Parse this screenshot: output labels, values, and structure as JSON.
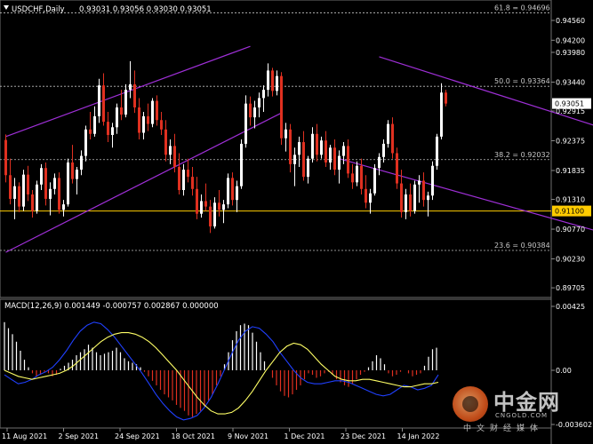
{
  "header": {
    "symbol_label": "USDCHF,Daily",
    "ohlc": "0.93031 0.93056 0.93030 0.93051"
  },
  "macd": {
    "label": "MACD(12,26,9) 0.001449 -0.000757 0.002867 0.000000",
    "ticks": [
      "0.00425",
      "0.00",
      "-0.003602"
    ]
  },
  "colors": {
    "background": "#000000",
    "bull": "#ffffff",
    "bear": "#e03020",
    "channel": "#9e2fd6",
    "support": "#ffcc00",
    "fib_grid": "#c0c0c0",
    "macd_signal": "#ffff66",
    "macd_line": "#2040ff"
  },
  "chart_data": [
    {
      "type": "candlestick",
      "title": "USDCHF,Daily",
      "ylim": [
        0.8961,
        0.9485
      ],
      "y_ticks": [
        "0.94560",
        "0.94200",
        "0.93980",
        "0.93440",
        "0.92915",
        "0.92375",
        "0.91835",
        "0.91310",
        "0.90770",
        "0.90230",
        "0.89705"
      ],
      "x_tick_labels": [
        "11 Aug 2021",
        "2 Sep 2021",
        "24 Sep 2021",
        "18 Oct 2021",
        "9 Nov 2021",
        "1 Dec 2021",
        "23 Dec 2021",
        "14 Jan 2022"
      ],
      "current_price": "0.93051",
      "support_level": {
        "value": 0.911,
        "label": "0.91100"
      },
      "fibonacci": [
        {
          "level": "61.8",
          "value": 0.94696,
          "label": "61.8 = 0.94696"
        },
        {
          "level": "50.0",
          "value": 0.93364,
          "label": "50.0 = 0.93364"
        },
        {
          "level": "38.2",
          "value": 0.92032,
          "label": "38.2 = 0.92032"
        },
        {
          "level": "23.6",
          "value": 0.90384,
          "label": "23.6 = 0.90384"
        }
      ],
      "channels": [
        {
          "name": "ascending",
          "lines": [
            {
              "from": [
                0,
                0.9245
              ],
              "to": [
                55,
                0.9409
              ]
            },
            {
              "from": [
                0,
                0.9035
              ],
              "to": [
                62,
                0.9288
              ]
            }
          ]
        },
        {
          "name": "descending",
          "lines": [
            {
              "from": [
                84,
                0.939
              ],
              "to": [
                152,
                0.9215
              ]
            },
            {
              "from": [
                75,
                0.9205
              ],
              "to": [
                150,
                0.9035
              ]
            }
          ]
        }
      ],
      "ohlc": [
        [
          0.9239,
          0.9249,
          0.9162,
          0.9175
        ],
        [
          0.9175,
          0.9205,
          0.9122,
          0.9132
        ],
        [
          0.9132,
          0.917,
          0.9095,
          0.9155
        ],
        [
          0.9155,
          0.9162,
          0.9108,
          0.9118
        ],
        [
          0.9118,
          0.9185,
          0.911,
          0.9176
        ],
        [
          0.9176,
          0.9192,
          0.9128,
          0.914
        ],
        [
          0.914,
          0.9148,
          0.9098,
          0.911
        ],
        [
          0.911,
          0.9165,
          0.9105,
          0.9158
        ],
        [
          0.9158,
          0.9195,
          0.9148,
          0.9188
        ],
        [
          0.9188,
          0.9198,
          0.912,
          0.9132
        ],
        [
          0.9132,
          0.9162,
          0.9102,
          0.915
        ],
        [
          0.915,
          0.9178,
          0.914,
          0.917
        ],
        [
          0.917,
          0.918,
          0.9105,
          0.9112
        ],
        [
          0.9112,
          0.913,
          0.91,
          0.9122
        ],
        [
          0.9122,
          0.9205,
          0.9118,
          0.9198
        ],
        [
          0.9198,
          0.923,
          0.916,
          0.9168
        ],
        [
          0.9168,
          0.919,
          0.914,
          0.9185
        ],
        [
          0.9185,
          0.922,
          0.9175,
          0.921
        ],
        [
          0.921,
          0.9265,
          0.92,
          0.9258
        ],
        [
          0.9258,
          0.929,
          0.924,
          0.925
        ],
        [
          0.925,
          0.93,
          0.9245,
          0.9282
        ],
        [
          0.9282,
          0.935,
          0.927,
          0.9338
        ],
        [
          0.9338,
          0.936,
          0.9265,
          0.9272
        ],
        [
          0.9272,
          0.929,
          0.9235,
          0.9248
        ],
        [
          0.9248,
          0.927,
          0.9225,
          0.9262
        ],
        [
          0.9262,
          0.9305,
          0.925,
          0.9298
        ],
        [
          0.9298,
          0.933,
          0.9275,
          0.9285
        ],
        [
          0.9285,
          0.934,
          0.928,
          0.933
        ],
        [
          0.933,
          0.9382,
          0.9315,
          0.934
        ],
        [
          0.934,
          0.9365,
          0.9288,
          0.9298
        ],
        [
          0.9298,
          0.9315,
          0.924,
          0.9252
        ],
        [
          0.9252,
          0.929,
          0.924,
          0.9282
        ],
        [
          0.9282,
          0.9305,
          0.9255,
          0.9268
        ],
        [
          0.9268,
          0.9315,
          0.9262,
          0.931
        ],
        [
          0.931,
          0.932,
          0.9265,
          0.9275
        ],
        [
          0.9275,
          0.929,
          0.9248,
          0.9258
        ],
        [
          0.9258,
          0.9275,
          0.92,
          0.9212
        ],
        [
          0.9212,
          0.924,
          0.9195,
          0.9228
        ],
        [
          0.9228,
          0.925,
          0.918,
          0.919
        ],
        [
          0.919,
          0.9215,
          0.914,
          0.9148
        ],
        [
          0.9148,
          0.9195,
          0.9138,
          0.9185
        ],
        [
          0.9185,
          0.9205,
          0.9162,
          0.9172
        ],
        [
          0.9172,
          0.919,
          0.9138,
          0.915
        ],
        [
          0.915,
          0.9172,
          0.9095,
          0.9105
        ],
        [
          0.9105,
          0.914,
          0.9098,
          0.9128
        ],
        [
          0.9128,
          0.916,
          0.911,
          0.9118
        ],
        [
          0.9118,
          0.913,
          0.907,
          0.9082
        ],
        [
          0.9082,
          0.9135,
          0.9078,
          0.9125
        ],
        [
          0.9125,
          0.9148,
          0.91,
          0.9112
        ],
        [
          0.9112,
          0.913,
          0.9088,
          0.9122
        ],
        [
          0.9122,
          0.9178,
          0.9115,
          0.917
        ],
        [
          0.917,
          0.918,
          0.912,
          0.913
        ],
        [
          0.913,
          0.9165,
          0.9108,
          0.9155
        ],
        [
          0.9155,
          0.924,
          0.915,
          0.9232
        ],
        [
          0.9232,
          0.932,
          0.9225,
          0.9305
        ],
        [
          0.9305,
          0.9318,
          0.9265,
          0.928
        ],
        [
          0.928,
          0.931,
          0.926,
          0.9298
        ],
        [
          0.9298,
          0.9325,
          0.928,
          0.9315
        ],
        [
          0.9315,
          0.9338,
          0.929,
          0.933
        ],
        [
          0.933,
          0.9378,
          0.9318,
          0.9365
        ],
        [
          0.9365,
          0.937,
          0.9318,
          0.9328
        ],
        [
          0.9328,
          0.9365,
          0.932,
          0.9355
        ],
        [
          0.9355,
          0.9362,
          0.923,
          0.9242
        ],
        [
          0.9242,
          0.927,
          0.9218,
          0.9258
        ],
        [
          0.9258,
          0.9268,
          0.918,
          0.9195
        ],
        [
          0.9195,
          0.9225,
          0.9155,
          0.9212
        ],
        [
          0.9212,
          0.9245,
          0.919,
          0.9235
        ],
        [
          0.9235,
          0.9255,
          0.9165,
          0.9172
        ],
        [
          0.9172,
          0.921,
          0.916,
          0.9205
        ],
        [
          0.9205,
          0.9262,
          0.9198,
          0.925
        ],
        [
          0.925,
          0.9268,
          0.92,
          0.9212
        ],
        [
          0.9212,
          0.9245,
          0.9205,
          0.9238
        ],
        [
          0.9238,
          0.9255,
          0.919,
          0.9198
        ],
        [
          0.9198,
          0.923,
          0.9185,
          0.9225
        ],
        [
          0.9225,
          0.924,
          0.9175,
          0.9185
        ],
        [
          0.9185,
          0.922,
          0.916,
          0.921
        ],
        [
          0.921,
          0.9235,
          0.9195,
          0.9228
        ],
        [
          0.9228,
          0.924,
          0.917,
          0.9178
        ],
        [
          0.9178,
          0.9195,
          0.915,
          0.9162
        ],
        [
          0.9162,
          0.92,
          0.9155,
          0.9192
        ],
        [
          0.9192,
          0.9205,
          0.914,
          0.915
        ],
        [
          0.915,
          0.9175,
          0.9115,
          0.9125
        ],
        [
          0.9125,
          0.915,
          0.9105,
          0.9142
        ],
        [
          0.9142,
          0.9195,
          0.9138,
          0.9188
        ],
        [
          0.9188,
          0.9215,
          0.9175,
          0.9208
        ],
        [
          0.9208,
          0.924,
          0.9198,
          0.9232
        ],
        [
          0.9232,
          0.9275,
          0.9225,
          0.9268
        ],
        [
          0.9268,
          0.928,
          0.9205,
          0.9215
        ],
        [
          0.9215,
          0.9225,
          0.915,
          0.916
        ],
        [
          0.916,
          0.9185,
          0.9098,
          0.9108
        ],
        [
          0.9108,
          0.915,
          0.9095,
          0.914
        ],
        [
          0.914,
          0.916,
          0.91,
          0.911
        ],
        [
          0.911,
          0.9165,
          0.9105,
          0.9158
        ],
        [
          0.9158,
          0.9175,
          0.9125,
          0.9165
        ],
        [
          0.9165,
          0.918,
          0.9118,
          0.913
        ],
        [
          0.913,
          0.9145,
          0.91,
          0.9138
        ],
        [
          0.9138,
          0.92,
          0.913,
          0.9192
        ],
        [
          0.9192,
          0.925,
          0.9185,
          0.9245
        ],
        [
          0.9245,
          0.9342,
          0.924,
          0.9325
        ],
        [
          0.9325,
          0.933,
          0.93,
          0.9305
        ]
      ]
    },
    {
      "type": "bar+line",
      "title": "MACD(12,26,9)",
      "ylim": [
        -0.003602,
        0.00425
      ],
      "y_ticks": [
        "0.00425",
        "0.00",
        "-0.003602"
      ],
      "series": [
        {
          "name": "histogram",
          "values": [
            0.0032,
            0.0028,
            0.0024,
            0.0019,
            0.0013,
            0.0007,
            0.0002,
            -0.0002,
            -0.0004,
            -0.0003,
            -0.0001,
            -0.0002,
            -0.0004,
            -0.0003,
            0.0001,
            0.0003,
            0.0005,
            0.0007,
            0.001,
            0.0012,
            0.0014,
            0.0017,
            0.0015,
            0.0012,
            0.001,
            0.0011,
            0.0012,
            0.0013,
            0.0015,
            0.0012,
            0.0008,
            0.0006,
            0.0005,
            0.0004,
            0.0002,
            -0.0001,
            -0.0004,
            -0.0007,
            -0.001,
            -0.0013,
            -0.0016,
            -0.0018,
            -0.002,
            -0.0023,
            -0.0025,
            -0.0027,
            -0.003,
            -0.0031,
            -0.0029,
            -0.0027,
            -0.0024,
            -0.002,
            -0.0016,
            -0.001,
            -0.0004,
            0.0004,
            0.0012,
            0.002,
            0.0026,
            0.003,
            0.0031,
            0.003,
            0.0025,
            0.0019,
            0.0012,
            0.0006,
            0.0,
            -0.0005,
            -0.001,
            -0.0014,
            -0.0017,
            -0.0018,
            -0.0016,
            -0.0013,
            -0.001,
            -0.0006,
            -0.0002,
            -0.0003,
            -0.0005,
            -0.0004,
            -0.0002,
            -0.0001,
            -0.0003,
            -0.0006,
            -0.0008,
            -0.001,
            -0.0011,
            -0.0009,
            -0.0006,
            -0.0003,
            -0.0001,
            0.0002,
            0.0006,
            0.001,
            0.0008,
            0.0004,
            -0.0002,
            -0.0004,
            -0.0003,
            -0.0001,
            0.0,
            -0.0002,
            -0.0004,
            -0.0003,
            -0.0002,
            0.0003,
            0.0009,
            0.0014,
            0.0015
          ]
        },
        {
          "name": "signal",
          "values": [
            0.0,
            -0.0002,
            -0.0004,
            -0.0005,
            -0.0006,
            -0.0005,
            -0.0004,
            -0.0003,
            -0.0002,
            0.0,
            0.0003,
            0.0007,
            0.0011,
            0.0015,
            0.0019,
            0.0022,
            0.0024,
            0.0025,
            0.0025,
            0.0024,
            0.0022,
            0.0019,
            0.0015,
            0.001,
            0.0005,
            0.0,
            -0.0006,
            -0.0012,
            -0.0018,
            -0.0023,
            -0.0027,
            -0.0029,
            -0.0029,
            -0.0028,
            -0.0025,
            -0.002,
            -0.0014,
            -0.0007,
            0.0,
            0.0006,
            0.0012,
            0.0016,
            0.0018,
            0.0017,
            0.0014,
            0.0009,
            0.0004,
            0.0,
            -0.0004,
            -0.0006,
            -0.0007,
            -0.0007,
            -0.0006,
            -0.0006,
            -0.0007,
            -0.0008,
            -0.0009,
            -0.001,
            -0.0011,
            -0.0011,
            -0.001,
            -0.0009,
            -0.0009,
            -0.0008
          ]
        },
        {
          "name": "macd",
          "values": [
            -0.0003,
            -0.0006,
            -0.0009,
            -0.0008,
            -0.0006,
            -0.0003,
            -0.0001,
            0.0002,
            0.0007,
            0.0013,
            0.002,
            0.0026,
            0.003,
            0.0032,
            0.0031,
            0.0027,
            0.0022,
            0.0016,
            0.001,
            0.0004,
            -0.0002,
            -0.0009,
            -0.0016,
            -0.0022,
            -0.0027,
            -0.0031,
            -0.0033,
            -0.0032,
            -0.003,
            -0.0025,
            -0.0018,
            -0.0009,
            0.0001,
            0.0011,
            0.002,
            0.0026,
            0.0029,
            0.0028,
            0.0024,
            0.0019,
            0.0012,
            0.0006,
            0.0,
            -0.0005,
            -0.0008,
            -0.0009,
            -0.0009,
            -0.0008,
            -0.0007,
            -0.0007,
            -0.0008,
            -0.001,
            -0.0012,
            -0.0014,
            -0.0016,
            -0.0017,
            -0.0016,
            -0.0013,
            -0.001,
            -0.0011,
            -0.0013,
            -0.0012,
            -0.001,
            -0.0003
          ]
        }
      ]
    }
  ]
}
